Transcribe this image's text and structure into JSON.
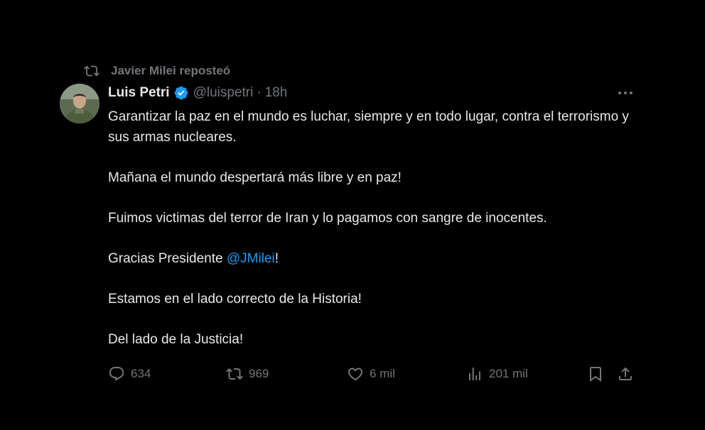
{
  "repost_banner": {
    "text": "Javier Milei reposteó",
    "icon": "repost-icon"
  },
  "author": {
    "name": "Luis Petri",
    "handle": "@luispetri",
    "separator": "·",
    "time": "18h",
    "verified": true,
    "verified_color": "#1d9bf0"
  },
  "tweet": {
    "p1": "Garantizar la paz en el mundo es luchar, siempre y en todo lugar, contra el terrorismo y sus armas nucleares.",
    "p2": "Mañana el mundo despertará más libre y en paz!",
    "p3": "Fuimos victimas del terror de Iran y lo pagamos con sangre de inocentes.",
    "p4_before": "Gracias Presidente ",
    "p4_mention": "@JMilei",
    "p4_after": "!",
    "p5": "Estamos en el lado correcto de la Historia!",
    "p6": "Del lado de la Justicia!"
  },
  "actions": {
    "replies": "634",
    "reposts": "969",
    "likes": "6 mil",
    "views": "201 mil"
  },
  "colors": {
    "background": "#000000",
    "text": "#e7e9ea",
    "muted": "#71767b",
    "link": "#1d9bf0"
  }
}
